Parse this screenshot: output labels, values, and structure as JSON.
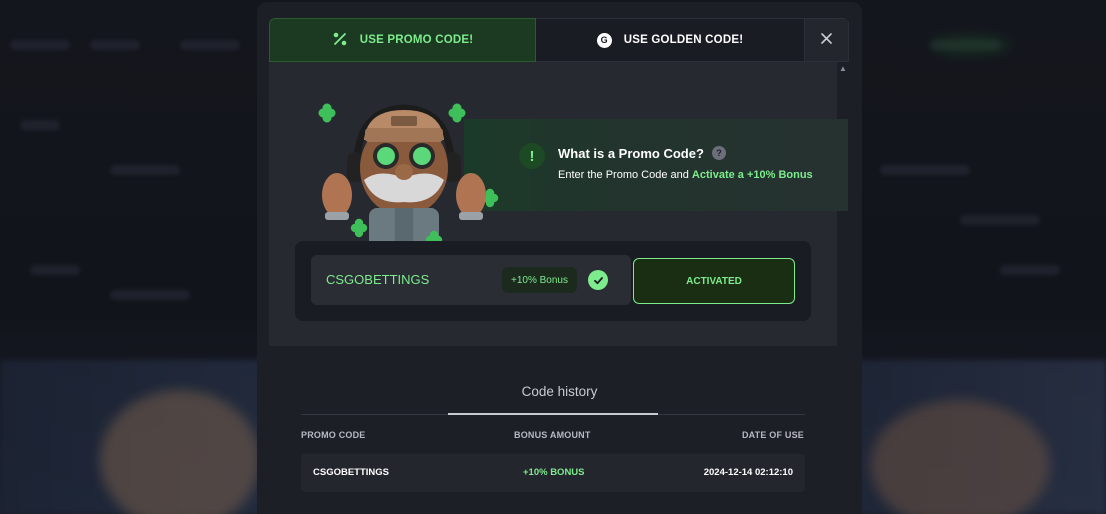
{
  "tabs": {
    "promo_label": "USE PROMO CODE!",
    "golden_label": "USE GOLDEN CODE!",
    "golden_coin_letter": "G",
    "close_icon": "close-icon"
  },
  "info": {
    "title": "What is a Promo Code?",
    "subtitle_prefix": "Enter the Promo Code and ",
    "subtitle_highlight": "Activate a +10% Bonus",
    "icon_symbol": "!",
    "help_symbol": "?"
  },
  "promo": {
    "code": "CSGOBETTINGS",
    "bonus_badge": "+10% Bonus",
    "button_label": "ACTIVATED"
  },
  "history": {
    "title": "Code history",
    "columns": [
      "PROMO CODE",
      "BONUS AMOUNT",
      "DATE OF USE"
    ],
    "rows": [
      {
        "code": "CSGOBETTINGS",
        "bonus": "+10% BONUS",
        "date": "2024-12-14 02:12:10"
      }
    ]
  },
  "colors": {
    "accent_green": "#7dec8c",
    "modal_bg": "#1d1f27",
    "panel_bg": "#272931"
  }
}
